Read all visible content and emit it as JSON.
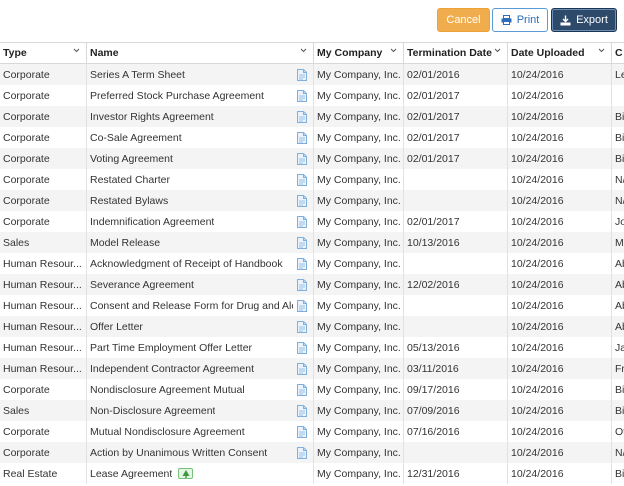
{
  "toolbar": {
    "cancel_label": "Cancel",
    "print_label": "Print",
    "export_label": "Export"
  },
  "columns": {
    "type": "Type",
    "name": "Name",
    "company": "My Company",
    "termination": "Termination Date",
    "uploaded": "Date Uploaded",
    "c": "C"
  },
  "rows": [
    {
      "type": "Corporate",
      "name": "Series A Term Sheet",
      "company": "My Company, Inc.",
      "termination": "02/01/2016",
      "uploaded": "10/24/2016",
      "c": "Le"
    },
    {
      "type": "Corporate",
      "name": "Preferred Stock Purchase Agreement",
      "company": "My Company, Inc.",
      "termination": "02/01/2017",
      "uploaded": "10/24/2016",
      "c": ""
    },
    {
      "type": "Corporate",
      "name": "Investor Rights Agreement",
      "company": "My Company, Inc.",
      "termination": "02/01/2017",
      "uploaded": "10/24/2016",
      "c": "Bi"
    },
    {
      "type": "Corporate",
      "name": "Co-Sale Agreement",
      "company": "My Company, Inc.",
      "termination": "02/01/2017",
      "uploaded": "10/24/2016",
      "c": "Bi"
    },
    {
      "type": "Corporate",
      "name": "Voting Agreement",
      "company": "My Company, Inc.",
      "termination": "02/01/2017",
      "uploaded": "10/24/2016",
      "c": "Bi"
    },
    {
      "type": "Corporate",
      "name": "Restated Charter",
      "company": "My Company, Inc.",
      "termination": "",
      "uploaded": "10/24/2016",
      "c": "N/"
    },
    {
      "type": "Corporate",
      "name": "Restated Bylaws",
      "company": "My Company, Inc.",
      "termination": "",
      "uploaded": "10/24/2016",
      "c": "N/"
    },
    {
      "type": "Corporate",
      "name": "Indemnification Agreement",
      "company": "My Company, Inc.",
      "termination": "02/01/2017",
      "uploaded": "10/24/2016",
      "c": "Jo"
    },
    {
      "type": "Sales",
      "name": "Model Release",
      "company": "My Company, Inc.",
      "termination": "10/13/2016",
      "uploaded": "10/24/2016",
      "c": "Mo"
    },
    {
      "type": "Human Resour...",
      "name": "Acknowledgment of Receipt of Handbook",
      "company": "My Company, Inc.",
      "termination": "",
      "uploaded": "10/24/2016",
      "c": "Ab"
    },
    {
      "type": "Human Resour...",
      "name": "Severance Agreement",
      "company": "My Company, Inc.",
      "termination": "12/02/2016",
      "uploaded": "10/24/2016",
      "c": "Ab"
    },
    {
      "type": "Human Resour...",
      "name": "Consent and Release Form for Drug and Alcohol",
      "company": "My Company, Inc.",
      "termination": "",
      "uploaded": "10/24/2016",
      "c": "Ab"
    },
    {
      "type": "Human Resour...",
      "name": "Offer Letter",
      "company": "My Company, Inc.",
      "termination": "",
      "uploaded": "10/24/2016",
      "c": "Ab"
    },
    {
      "type": "Human Resour...",
      "name": "Part Time Employment Offer Letter",
      "company": "My Company, Inc.",
      "termination": "05/13/2016",
      "uploaded": "10/24/2016",
      "c": "Ja"
    },
    {
      "type": "Human Resour...",
      "name": "Independent Contractor Agreement",
      "company": "My Company, Inc.",
      "termination": "03/11/2016",
      "uploaded": "10/24/2016",
      "c": "Fra"
    },
    {
      "type": "Corporate",
      "name": "Nondisclosure Agreement Mutual",
      "company": "My Company, Inc.",
      "termination": "09/17/2016",
      "uploaded": "10/24/2016",
      "c": "Bi"
    },
    {
      "type": "Sales",
      "name": "Non-Disclosure Agreement",
      "company": "My Company, Inc.",
      "termination": "07/09/2016",
      "uploaded": "10/24/2016",
      "c": "Bi"
    },
    {
      "type": "Corporate",
      "name": "Mutual Nondisclosure Agreement",
      "company": "My Company, Inc.",
      "termination": "07/16/2016",
      "uploaded": "10/24/2016",
      "c": "Ot"
    },
    {
      "type": "Corporate",
      "name": "Action by Unanimous Written Consent",
      "company": "My Company, Inc.",
      "termination": "",
      "uploaded": "10/24/2016",
      "c": "N/"
    },
    {
      "type": "Real Estate",
      "name": "Lease Agreement",
      "company": "My Company, Inc.",
      "termination": "12/31/2016",
      "uploaded": "10/24/2016",
      "c": "Bi",
      "tree_icon": true
    }
  ],
  "icons": {
    "print": "printer-icon",
    "export": "export-icon",
    "doc": "document-icon",
    "sort": "chevron-down-icon",
    "tree": "tree-icon"
  },
  "colors": {
    "cancel": "#f0ad4e",
    "export": "#2d4a6b",
    "print_text": "#2a6ebb"
  }
}
